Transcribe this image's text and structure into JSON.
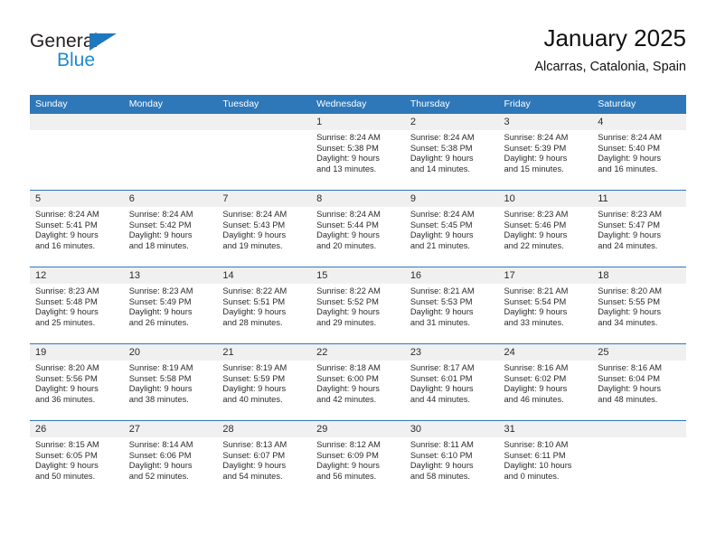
{
  "brand": {
    "word_one": "General",
    "word_two": "Blue",
    "triangle_color": "#1f77bd",
    "blue_color": "#1f8ad0"
  },
  "header": {
    "title": "January 2025",
    "subtitle": "Alcarras, Catalonia, Spain",
    "header_bg": "#2e78ba",
    "daynum_bg": "#f0f0f0"
  },
  "weekday_headers": [
    "Sunday",
    "Monday",
    "Tuesday",
    "Wednesday",
    "Thursday",
    "Friday",
    "Saturday"
  ],
  "weeks": [
    [
      {
        "day": "",
        "sunrise": "",
        "sunset": "",
        "daylight_line1": "",
        "daylight_line2": ""
      },
      {
        "day": "",
        "sunrise": "",
        "sunset": "",
        "daylight_line1": "",
        "daylight_line2": ""
      },
      {
        "day": "",
        "sunrise": "",
        "sunset": "",
        "daylight_line1": "",
        "daylight_line2": ""
      },
      {
        "day": "1",
        "sunrise": "Sunrise: 8:24 AM",
        "sunset": "Sunset: 5:38 PM",
        "daylight_line1": "Daylight: 9 hours",
        "daylight_line2": "and 13 minutes."
      },
      {
        "day": "2",
        "sunrise": "Sunrise: 8:24 AM",
        "sunset": "Sunset: 5:38 PM",
        "daylight_line1": "Daylight: 9 hours",
        "daylight_line2": "and 14 minutes."
      },
      {
        "day": "3",
        "sunrise": "Sunrise: 8:24 AM",
        "sunset": "Sunset: 5:39 PM",
        "daylight_line1": "Daylight: 9 hours",
        "daylight_line2": "and 15 minutes."
      },
      {
        "day": "4",
        "sunrise": "Sunrise: 8:24 AM",
        "sunset": "Sunset: 5:40 PM",
        "daylight_line1": "Daylight: 9 hours",
        "daylight_line2": "and 16 minutes."
      }
    ],
    [
      {
        "day": "5",
        "sunrise": "Sunrise: 8:24 AM",
        "sunset": "Sunset: 5:41 PM",
        "daylight_line1": "Daylight: 9 hours",
        "daylight_line2": "and 16 minutes."
      },
      {
        "day": "6",
        "sunrise": "Sunrise: 8:24 AM",
        "sunset": "Sunset: 5:42 PM",
        "daylight_line1": "Daylight: 9 hours",
        "daylight_line2": "and 18 minutes."
      },
      {
        "day": "7",
        "sunrise": "Sunrise: 8:24 AM",
        "sunset": "Sunset: 5:43 PM",
        "daylight_line1": "Daylight: 9 hours",
        "daylight_line2": "and 19 minutes."
      },
      {
        "day": "8",
        "sunrise": "Sunrise: 8:24 AM",
        "sunset": "Sunset: 5:44 PM",
        "daylight_line1": "Daylight: 9 hours",
        "daylight_line2": "and 20 minutes."
      },
      {
        "day": "9",
        "sunrise": "Sunrise: 8:24 AM",
        "sunset": "Sunset: 5:45 PM",
        "daylight_line1": "Daylight: 9 hours",
        "daylight_line2": "and 21 minutes."
      },
      {
        "day": "10",
        "sunrise": "Sunrise: 8:23 AM",
        "sunset": "Sunset: 5:46 PM",
        "daylight_line1": "Daylight: 9 hours",
        "daylight_line2": "and 22 minutes."
      },
      {
        "day": "11",
        "sunrise": "Sunrise: 8:23 AM",
        "sunset": "Sunset: 5:47 PM",
        "daylight_line1": "Daylight: 9 hours",
        "daylight_line2": "and 24 minutes."
      }
    ],
    [
      {
        "day": "12",
        "sunrise": "Sunrise: 8:23 AM",
        "sunset": "Sunset: 5:48 PM",
        "daylight_line1": "Daylight: 9 hours",
        "daylight_line2": "and 25 minutes."
      },
      {
        "day": "13",
        "sunrise": "Sunrise: 8:23 AM",
        "sunset": "Sunset: 5:49 PM",
        "daylight_line1": "Daylight: 9 hours",
        "daylight_line2": "and 26 minutes."
      },
      {
        "day": "14",
        "sunrise": "Sunrise: 8:22 AM",
        "sunset": "Sunset: 5:51 PM",
        "daylight_line1": "Daylight: 9 hours",
        "daylight_line2": "and 28 minutes."
      },
      {
        "day": "15",
        "sunrise": "Sunrise: 8:22 AM",
        "sunset": "Sunset: 5:52 PM",
        "daylight_line1": "Daylight: 9 hours",
        "daylight_line2": "and 29 minutes."
      },
      {
        "day": "16",
        "sunrise": "Sunrise: 8:21 AM",
        "sunset": "Sunset: 5:53 PM",
        "daylight_line1": "Daylight: 9 hours",
        "daylight_line2": "and 31 minutes."
      },
      {
        "day": "17",
        "sunrise": "Sunrise: 8:21 AM",
        "sunset": "Sunset: 5:54 PM",
        "daylight_line1": "Daylight: 9 hours",
        "daylight_line2": "and 33 minutes."
      },
      {
        "day": "18",
        "sunrise": "Sunrise: 8:20 AM",
        "sunset": "Sunset: 5:55 PM",
        "daylight_line1": "Daylight: 9 hours",
        "daylight_line2": "and 34 minutes."
      }
    ],
    [
      {
        "day": "19",
        "sunrise": "Sunrise: 8:20 AM",
        "sunset": "Sunset: 5:56 PM",
        "daylight_line1": "Daylight: 9 hours",
        "daylight_line2": "and 36 minutes."
      },
      {
        "day": "20",
        "sunrise": "Sunrise: 8:19 AM",
        "sunset": "Sunset: 5:58 PM",
        "daylight_line1": "Daylight: 9 hours",
        "daylight_line2": "and 38 minutes."
      },
      {
        "day": "21",
        "sunrise": "Sunrise: 8:19 AM",
        "sunset": "Sunset: 5:59 PM",
        "daylight_line1": "Daylight: 9 hours",
        "daylight_line2": "and 40 minutes."
      },
      {
        "day": "22",
        "sunrise": "Sunrise: 8:18 AM",
        "sunset": "Sunset: 6:00 PM",
        "daylight_line1": "Daylight: 9 hours",
        "daylight_line2": "and 42 minutes."
      },
      {
        "day": "23",
        "sunrise": "Sunrise: 8:17 AM",
        "sunset": "Sunset: 6:01 PM",
        "daylight_line1": "Daylight: 9 hours",
        "daylight_line2": "and 44 minutes."
      },
      {
        "day": "24",
        "sunrise": "Sunrise: 8:16 AM",
        "sunset": "Sunset: 6:02 PM",
        "daylight_line1": "Daylight: 9 hours",
        "daylight_line2": "and 46 minutes."
      },
      {
        "day": "25",
        "sunrise": "Sunrise: 8:16 AM",
        "sunset": "Sunset: 6:04 PM",
        "daylight_line1": "Daylight: 9 hours",
        "daylight_line2": "and 48 minutes."
      }
    ],
    [
      {
        "day": "26",
        "sunrise": "Sunrise: 8:15 AM",
        "sunset": "Sunset: 6:05 PM",
        "daylight_line1": "Daylight: 9 hours",
        "daylight_line2": "and 50 minutes."
      },
      {
        "day": "27",
        "sunrise": "Sunrise: 8:14 AM",
        "sunset": "Sunset: 6:06 PM",
        "daylight_line1": "Daylight: 9 hours",
        "daylight_line2": "and 52 minutes."
      },
      {
        "day": "28",
        "sunrise": "Sunrise: 8:13 AM",
        "sunset": "Sunset: 6:07 PM",
        "daylight_line1": "Daylight: 9 hours",
        "daylight_line2": "and 54 minutes."
      },
      {
        "day": "29",
        "sunrise": "Sunrise: 8:12 AM",
        "sunset": "Sunset: 6:09 PM",
        "daylight_line1": "Daylight: 9 hours",
        "daylight_line2": "and 56 minutes."
      },
      {
        "day": "30",
        "sunrise": "Sunrise: 8:11 AM",
        "sunset": "Sunset: 6:10 PM",
        "daylight_line1": "Daylight: 9 hours",
        "daylight_line2": "and 58 minutes."
      },
      {
        "day": "31",
        "sunrise": "Sunrise: 8:10 AM",
        "sunset": "Sunset: 6:11 PM",
        "daylight_line1": "Daylight: 10 hours",
        "daylight_line2": "and 0 minutes."
      },
      {
        "day": "",
        "sunrise": "",
        "sunset": "",
        "daylight_line1": "",
        "daylight_line2": ""
      }
    ]
  ]
}
